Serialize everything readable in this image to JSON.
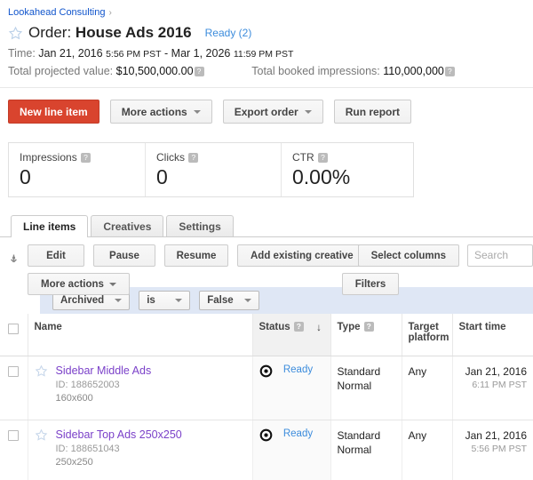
{
  "breadcrumb": {
    "label": "Lookahead Consulting",
    "separator": "›"
  },
  "header": {
    "title_prefix": "Order:",
    "title_name": "House Ads 2016",
    "status": "Ready (2)",
    "time_label": "Time:",
    "time_start_date": "Jan 21, 2016",
    "time_start_time": "5:56 PM PST",
    "time_dash": "-",
    "time_end_date": "Mar 1, 2026",
    "time_end_time": "11:59 PM PST",
    "projected_label": "Total projected value:",
    "projected_value": "$10,500,000.00",
    "booked_label": "Total booked impressions:",
    "booked_value": "110,000,000",
    "help_glyph": "?"
  },
  "actions": {
    "new_line_item": "New line item",
    "more_actions": "More actions",
    "export_order": "Export order",
    "run_report": "Run report"
  },
  "stats": [
    {
      "label": "Impressions",
      "value": "0"
    },
    {
      "label": "Clicks",
      "value": "0"
    },
    {
      "label": "CTR",
      "value": "0.00%"
    }
  ],
  "tabs": [
    {
      "label": "Line items",
      "active": true
    },
    {
      "label": "Creatives",
      "active": false
    },
    {
      "label": "Settings",
      "active": false
    }
  ],
  "toolbar": {
    "edit": "Edit",
    "pause": "Pause",
    "resume": "Resume",
    "add_existing_creative": "Add existing creative",
    "more_actions": "More actions",
    "filters": "Filters",
    "select_columns": "Select columns",
    "search_placeholder": "Search"
  },
  "filter": {
    "field": "Archived",
    "operator": "is",
    "value": "False"
  },
  "table": {
    "columns": [
      {
        "label": "Name",
        "help": false,
        "sorted": false
      },
      {
        "label": "Status",
        "help": true,
        "sorted": true
      },
      {
        "label": "Type",
        "help": true,
        "sorted": false
      },
      {
        "label": "Target platform",
        "help": false,
        "sorted": false
      },
      {
        "label": "Start time",
        "help": false,
        "sorted": false
      }
    ],
    "sort_direction": "↓",
    "rows": [
      {
        "name": "Sidebar Middle Ads",
        "id": "ID: 188652003",
        "size": "160x600",
        "status": "Ready",
        "type_line1": "Standard",
        "type_line2": "Normal",
        "target_platform": "Any",
        "start_date": "Jan 21, 2016",
        "start_time": "6:11 PM PST"
      },
      {
        "name": "Sidebar Top Ads 250x250",
        "id": "ID: 188651043",
        "size": "250x250",
        "status": "Ready",
        "type_line1": "Standard",
        "type_line2": "Normal",
        "target_platform": "Any",
        "start_date": "Jan 21, 2016",
        "start_time": "5:56 PM PST"
      }
    ]
  },
  "colors": {
    "primary_button": "#d9442e",
    "link": "#1155cc",
    "status_link": "#3c8cdc",
    "visited_link": "#7b41c9",
    "filter_bar": "#dfe7f5"
  }
}
